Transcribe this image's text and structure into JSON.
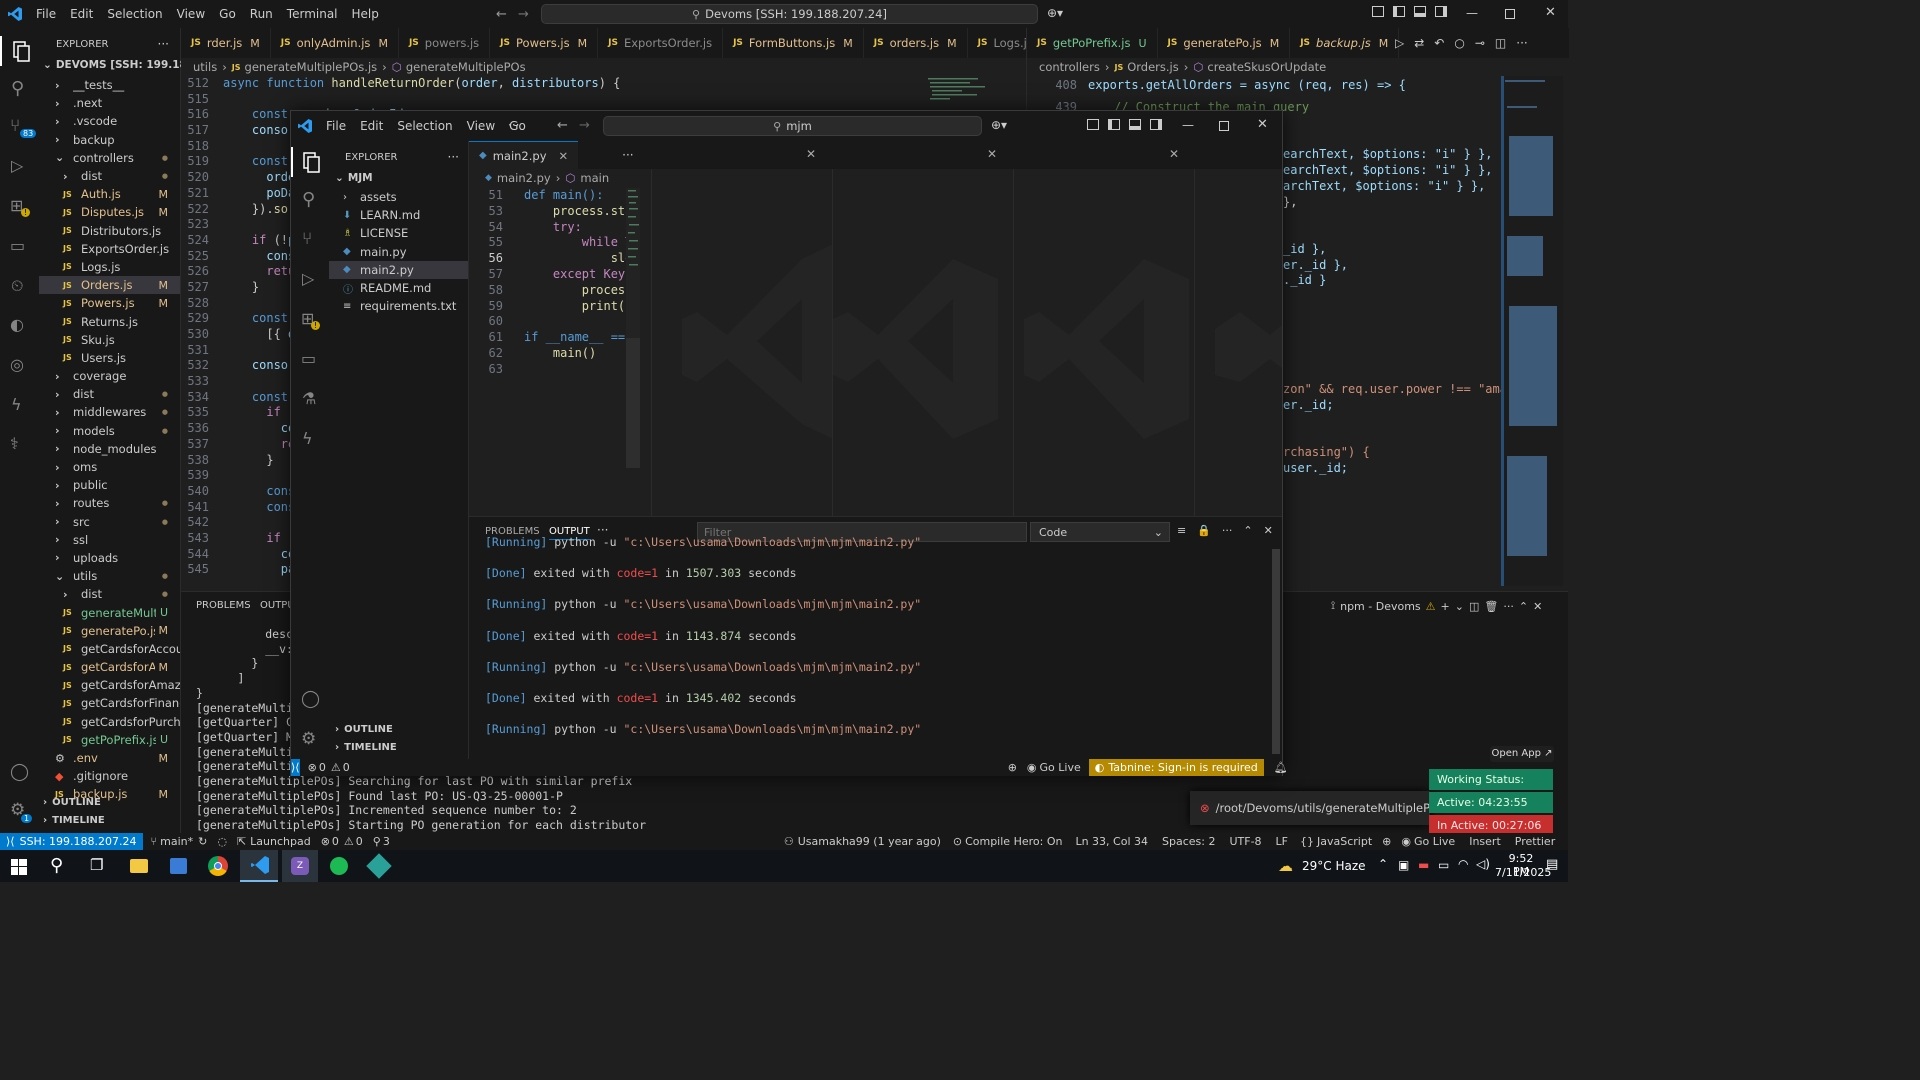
{
  "main": {
    "menu": [
      "File",
      "Edit",
      "Selection",
      "View",
      "Go",
      "Run",
      "Terminal",
      "Help"
    ],
    "search": "Devoms [SSH: 199.188.207.24]",
    "explorer_title": "EXPLORER",
    "root": "DEVOMS [SSH: 199.188.20...",
    "tree": [
      {
        "label": "__tests__",
        "type": "folder",
        "depth": 1,
        "mark": ""
      },
      {
        "label": ".next",
        "type": "folder",
        "depth": 1,
        "mark": ""
      },
      {
        "label": ".vscode",
        "type": "folder",
        "depth": 1,
        "mark": ""
      },
      {
        "label": "backup",
        "type": "folder",
        "depth": 1,
        "mark": ""
      },
      {
        "label": "controllers",
        "type": "folder-open",
        "depth": 1,
        "mark": "dot"
      },
      {
        "label": "dist",
        "type": "folder",
        "depth": 2,
        "mark": "dot"
      },
      {
        "label": "Auth.js",
        "type": "js",
        "depth": 2,
        "mark": "M"
      },
      {
        "label": "Disputes.js",
        "type": "js",
        "depth": 2,
        "mark": "M"
      },
      {
        "label": "Distributors.js",
        "type": "js",
        "depth": 2,
        "mark": ""
      },
      {
        "label": "ExportsOrder.js",
        "type": "js",
        "depth": 2,
        "mark": ""
      },
      {
        "label": "Logs.js",
        "type": "js",
        "depth": 2,
        "mark": ""
      },
      {
        "label": "Orders.js",
        "type": "js",
        "depth": 2,
        "mark": "M",
        "active": true
      },
      {
        "label": "Powers.js",
        "type": "js",
        "depth": 2,
        "mark": "M"
      },
      {
        "label": "Returns.js",
        "type": "js",
        "depth": 2,
        "mark": ""
      },
      {
        "label": "Sku.js",
        "type": "js",
        "depth": 2,
        "mark": ""
      },
      {
        "label": "Users.js",
        "type": "js",
        "depth": 2,
        "mark": ""
      },
      {
        "label": "coverage",
        "type": "folder",
        "depth": 1,
        "mark": ""
      },
      {
        "label": "dist",
        "type": "folder",
        "depth": 1,
        "mark": "dot"
      },
      {
        "label": "middlewares",
        "type": "folder",
        "depth": 1,
        "mark": "dot"
      },
      {
        "label": "models",
        "type": "folder",
        "depth": 1,
        "mark": "dot"
      },
      {
        "label": "node_modules",
        "type": "folder",
        "depth": 1,
        "mark": ""
      },
      {
        "label": "oms",
        "type": "folder",
        "depth": 1,
        "mark": ""
      },
      {
        "label": "public",
        "type": "folder",
        "depth": 1,
        "mark": ""
      },
      {
        "label": "routes",
        "type": "folder",
        "depth": 1,
        "mark": "dot"
      },
      {
        "label": "src",
        "type": "folder",
        "depth": 1,
        "mark": "dot"
      },
      {
        "label": "ssl",
        "type": "folder",
        "depth": 1,
        "mark": ""
      },
      {
        "label": "uploads",
        "type": "folder",
        "depth": 1,
        "mark": ""
      },
      {
        "label": "utils",
        "type": "folder-open",
        "depth": 1,
        "mark": "dot"
      },
      {
        "label": "dist",
        "type": "folder",
        "depth": 2,
        "mark": "dot"
      },
      {
        "label": "generateMulti...",
        "type": "js",
        "depth": 2,
        "mark": "U"
      },
      {
        "label": "generatePo.js",
        "type": "js",
        "depth": 2,
        "mark": "M"
      },
      {
        "label": "getCardsforAccount.js",
        "type": "js",
        "depth": 2,
        "mark": ""
      },
      {
        "label": "getCardsforAd...",
        "type": "js",
        "depth": 2,
        "mark": "M"
      },
      {
        "label": "getCardsforAmazon.js",
        "type": "js",
        "depth": 2,
        "mark": ""
      },
      {
        "label": "getCardsforFinance.js",
        "type": "js",
        "depth": 2,
        "mark": ""
      },
      {
        "label": "getCardsforPurchasi...",
        "type": "js",
        "depth": 2,
        "mark": ""
      },
      {
        "label": "getPoPrefix.js",
        "type": "js",
        "depth": 2,
        "mark": "U"
      },
      {
        "label": ".env",
        "type": "gear",
        "depth": 1,
        "mark": "M"
      },
      {
        "label": ".gitignore",
        "type": "git",
        "depth": 1,
        "mark": ""
      },
      {
        "label": "backup.js",
        "type": "js",
        "depth": 1,
        "mark": "M"
      }
    ],
    "outline": "OUTLINE",
    "timeline": "TIMELINE",
    "tabs_left": [
      {
        "label": "rder.js",
        "mark": "M"
      },
      {
        "label": "onlyAdmin.js",
        "mark": "M"
      },
      {
        "label": "powers.js",
        "mark": ""
      },
      {
        "label": "Powers.js",
        "mark": "M"
      },
      {
        "label": "ExportsOrder.js",
        "mark": ""
      },
      {
        "label": "FormButtons.js",
        "mark": "M"
      },
      {
        "label": "orders.js",
        "mark": "M"
      },
      {
        "label": "Logs.js",
        "mark": ""
      }
    ],
    "tabs_right": [
      {
        "label": "getPoPrefix.js",
        "mark": "U"
      },
      {
        "label": "generatePo.js",
        "mark": "M"
      },
      {
        "label": "backup.js",
        "mark": "M"
      }
    ],
    "breadcrumb_left": [
      "utils",
      "generateMultiplePOs.js",
      "generateMultiplePOs"
    ],
    "breadcrumb_right": [
      "controllers",
      "Orders.js",
      "createSkusOrUpdate"
    ],
    "left_lines": [
      "512",
      "515",
      "516",
      "517",
      "518",
      "519",
      "520",
      "521",
      "522",
      "523",
      "524",
      "525",
      "526",
      "527",
      "528",
      "529",
      "530",
      "531",
      "532",
      "533",
      "534",
      "535",
      "536",
      "537",
      "538",
      "539",
      "540",
      "541",
      "542",
      "543",
      "544",
      "545"
    ],
    "right_lines": [
      "408",
      "439"
    ],
    "right_code": {
      "l1": "exports.getAllOrders = async (req, res) => {",
      "l2": "// Construct the main query",
      "r1": "earchText, $options: \"i\" } },",
      "r2": "earchText, $options: \"i\" } },",
      "r3": "archText, $options: \"i\" } },",
      "r4": "},",
      "r5": "_id },",
      "r6": "er._id },",
      "r7": "._id }",
      "r8": "zon\" && req.user.power !== \"amazon",
      "r9": "er._id;",
      "r10": "rchasing\") {",
      "r11": "user._id;"
    },
    "panel_tabs": [
      "PROBLEMS",
      "OUTPUT"
    ],
    "terminal_label": "npm - Devoms",
    "terminal_lines": [
      "          description:",
      "          __v: 0",
      "        }",
      "      ]",
      "}",
      "[generateMultipleP",
      "[getQuarter] Calc",
      "[getQuarter] Mon",
      "[generateMultipl",
      "[generateMultipl",
      "[generateMultiplePOs] Searching for last PO with similar prefix",
      "[generateMultiplePOs] Found last PO: US-Q3-25-00001-P",
      "[generateMultiplePOs] Incremented sequence number to: 2",
      "[generateMultiplePOs] Starting PO generation for each distributor"
    ],
    "status": {
      "ssh": "SSH: 199.188.207.24",
      "branch": "main*",
      "launchpad": "Launchpad",
      "errors": "0",
      "warnings": "0",
      "ports": "3",
      "author": "Usamakha99 (1 year ago)",
      "compile": "Compile Hero: On",
      "position": "Ln 33, Col 34",
      "spaces": "Spaces: 2",
      "encoding": "UTF-8",
      "eol": "LF",
      "lang": "JavaScript",
      "golive": "Go Live",
      "insert": "Insert",
      "prettier": "Prettier"
    },
    "notification": "/root/Devoms/utils/generateMultiplePOs.js:",
    "open_app": "Open App ↗",
    "work_status": "Working Status: Active",
    "active_time": "Active: 04:23:55",
    "inactive_time": "In Active: 00:27:06"
  },
  "second": {
    "menu": [
      "File",
      "Edit",
      "Selection",
      "View",
      "Go"
    ],
    "search": "mjm",
    "explorer_title": "EXPLORER",
    "root": "MJM",
    "tree": [
      {
        "label": "assets",
        "type": "folder"
      },
      {
        "label": "LEARN.md",
        "type": "md"
      },
      {
        "label": "LICENSE",
        "type": "lic"
      },
      {
        "label": "main.py",
        "type": "py"
      },
      {
        "label": "main2.py",
        "type": "py",
        "active": true
      },
      {
        "label": "README.md",
        "type": "info"
      },
      {
        "label": "requirements.txt",
        "type": "txt"
      }
    ],
    "tab": "main2.py",
    "breadcrumb": [
      "main2.py",
      "main"
    ],
    "code_lines": [
      {
        "n": "51",
        "t": "def main():"
      },
      {
        "n": "53",
        "t": "    process.sta"
      },
      {
        "n": "54",
        "t": "    try:"
      },
      {
        "n": "55",
        "t": "        while T"
      },
      {
        "n": "56",
        "t": "            sle"
      },
      {
        "n": "57",
        "t": "    except Keyb"
      },
      {
        "n": "58",
        "t": "        process"
      },
      {
        "n": "59",
        "t": "        print(\""
      },
      {
        "n": "60",
        "t": ""
      },
      {
        "n": "61",
        "t": "if __name__ =="
      },
      {
        "n": "62",
        "t": "    main()"
      },
      {
        "n": "63",
        "t": ""
      }
    ],
    "outline": "OUTLINE",
    "timeline": "TIMELINE",
    "panel_tabs": [
      "PROBLEMS",
      "OUTPUT"
    ],
    "filter_placeholder": "Filter",
    "output_select": "Code",
    "output_lines": [
      {
        "kind": "run",
        "text": "[Running] python -u \"c:\\Users\\usama\\Downloads\\mjm\\mjm\\main2.py\""
      },
      {
        "kind": "blank",
        "text": ""
      },
      {
        "kind": "done",
        "text": "[Done] exited with code=1 in 1507.303 seconds"
      },
      {
        "kind": "blank",
        "text": ""
      },
      {
        "kind": "run",
        "text": "[Running] python -u \"c:\\Users\\usama\\Downloads\\mjm\\mjm\\main2.py\""
      },
      {
        "kind": "blank",
        "text": ""
      },
      {
        "kind": "done",
        "text": "[Done] exited with code=1 in 1143.874 seconds"
      },
      {
        "kind": "blank",
        "text": ""
      },
      {
        "kind": "run",
        "text": "[Running] python -u \"c:\\Users\\usama\\Downloads\\mjm\\mjm\\main2.py\""
      },
      {
        "kind": "blank",
        "text": ""
      },
      {
        "kind": "done",
        "text": "[Done] exited with code=1 in 1345.402 seconds"
      },
      {
        "kind": "blank",
        "text": ""
      },
      {
        "kind": "run",
        "text": "[Running] python -u \"c:\\Users\\usama\\Downloads\\mjm\\mjm\\main2.py\""
      }
    ],
    "status": {
      "errors": "0",
      "warnings": "0",
      "golive": "Go Live",
      "tabnine": "Tabnine: Sign-in is required"
    }
  },
  "taskbar": {
    "weather": "29°C Haze",
    "time": "9:52 PM",
    "date": "7/11/2025"
  },
  "colors": {
    "accent": "#007acc",
    "js": "#e8c547",
    "modified": "#e2c08d",
    "untracked": "#73c991",
    "working": "#16825d",
    "inactive": "#c72e2e",
    "tabnine": "#b58900"
  }
}
